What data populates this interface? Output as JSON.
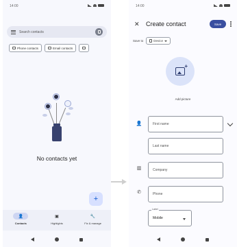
{
  "left_screen": {
    "status": {
      "time": "14:00"
    },
    "search": {
      "placeholder": "Search contacts"
    },
    "chips": [
      "Phone contacts",
      "Email contacts",
      ""
    ],
    "empty_state": {
      "text": "No contacts yet"
    },
    "fab": {
      "icon": "plus-icon",
      "symbol": "+"
    },
    "bottom_nav": [
      {
        "label": "Contacts",
        "icon": "person-icon",
        "symbol": "👤",
        "active": true
      },
      {
        "label": "Highlights",
        "icon": "highlights-icon",
        "symbol": "▣",
        "active": false
      },
      {
        "label": "Fix & manage",
        "icon": "wrench-icon",
        "symbol": "🔧",
        "active": false
      }
    ]
  },
  "right_screen": {
    "status": {
      "time": "14:00"
    },
    "title": "Create contact",
    "save_label": "Save",
    "save_to": {
      "label": "Save to",
      "device": "Device"
    },
    "add_picture": "Add picture",
    "fields": {
      "first_name": "First name",
      "last_name": "Last name",
      "company": "Company",
      "phone": "Phone"
    },
    "phone_label": {
      "legend": "Label",
      "value": "Mobile"
    }
  },
  "colors": {
    "accent": "#3a4fa0",
    "fab_bg": "#d7e0ff",
    "picture_circle": "#dbe3f9"
  }
}
